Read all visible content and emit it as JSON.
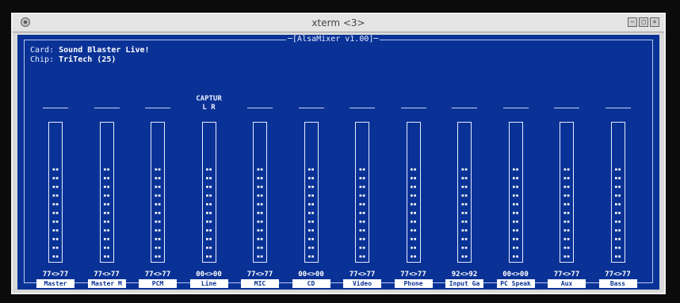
{
  "window": {
    "title": "xterm <3>"
  },
  "app": {
    "title": "AlsaMixer v1.00"
  },
  "info": {
    "card_label": "Card:",
    "card_value": "Sound Blaster Live!",
    "chip_label": "Chip:",
    "chip_value": "TriTech (25)"
  },
  "channels": [
    {
      "name": "Master",
      "volume": "77<>77",
      "top": "",
      "top2": "",
      "level": 11
    },
    {
      "name": "Master M",
      "volume": "77<>77",
      "top": "",
      "top2": "",
      "level": 11
    },
    {
      "name": "PCM",
      "volume": "77<>77",
      "top": "",
      "top2": "",
      "level": 11
    },
    {
      "name": "Line",
      "volume": "00<>00",
      "top": "CAPTUR",
      "top2": "L   R",
      "level": 11
    },
    {
      "name": "MIC",
      "volume": "77<>77",
      "top": "",
      "top2": "",
      "level": 11
    },
    {
      "name": "CD",
      "volume": "00<>00",
      "top": "",
      "top2": "",
      "level": 11
    },
    {
      "name": "Video",
      "volume": "77<>77",
      "top": "",
      "top2": "",
      "level": 11
    },
    {
      "name": "Phone",
      "volume": "77<>77",
      "top": "",
      "top2": "",
      "level": 11
    },
    {
      "name": "Input Ga",
      "volume": "92<>92",
      "top": "",
      "top2": "",
      "level": 11
    },
    {
      "name": "PC Speak",
      "volume": "00<>00",
      "top": "",
      "top2": "",
      "level": 11
    },
    {
      "name": "Aux",
      "volume": "77<>77",
      "top": "",
      "top2": "",
      "level": 11
    },
    {
      "name": "Bass",
      "volume": "77<>77",
      "top": "",
      "top2": "",
      "level": 11
    }
  ],
  "colors": {
    "terminal_bg": "#0a3296",
    "text": "#ffffff"
  }
}
